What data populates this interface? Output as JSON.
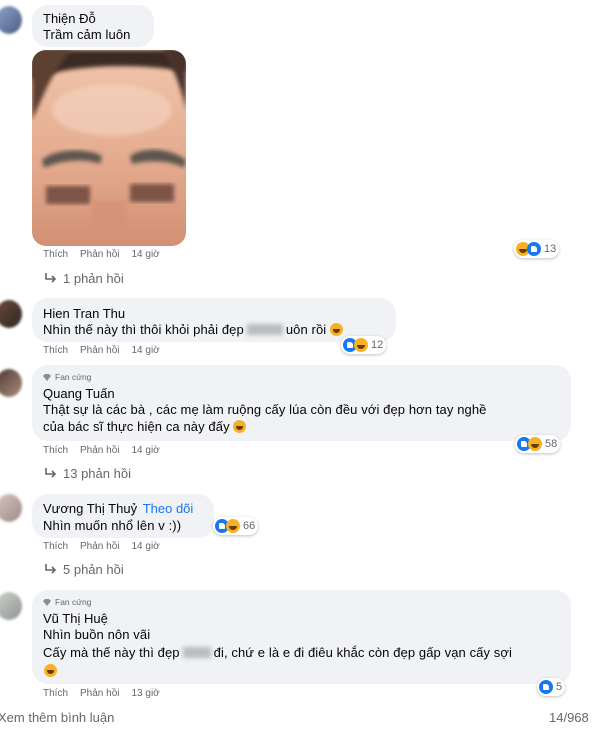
{
  "common": {
    "like": "Thích",
    "reply": "Phản hồi"
  },
  "comments": [
    {
      "name": "Thiện Đỗ",
      "lines": [
        "Trầm cảm luôn"
      ],
      "time": "14 giờ",
      "reactions": {
        "icons": [
          "haha-icon",
          "like-icon"
        ],
        "count": "13"
      },
      "replies": "1 phản hồi"
    },
    {
      "name": "Hien Tran Thu",
      "lines": [
        "Nhìn thế này thì thôi khỏi phải đẹp",
        "uôn rồi"
      ],
      "time": "14 giờ",
      "reactions": {
        "icons": [
          "like-icon",
          "haha-icon"
        ],
        "count": "12"
      }
    },
    {
      "badge": "Fan cứng",
      "name": "Quang Tuấn",
      "lines": [
        "Thật sự là các bà , các mẹ làm ruộng cấy lúa còn đều với đẹp hơn tay nghề",
        "của bác sĩ thực hiện ca này đấy"
      ],
      "time": "14 giờ",
      "reactions": {
        "icons": [
          "like-icon",
          "haha-icon"
        ],
        "count": "58"
      },
      "replies": "13 phản hồi"
    },
    {
      "name": "Vương Thị Thuỷ",
      "follow": "Theo dõi",
      "lines": [
        "Nhìn muốn nhổ lên v :))"
      ],
      "time": "14 giờ",
      "reactions": {
        "icons": [
          "like-icon",
          "haha-icon"
        ],
        "count": "66"
      },
      "replies": "5 phản hồi"
    },
    {
      "badge": "Fan cứng",
      "name": "Vũ Thị Huệ",
      "lines": [
        "Nhìn buồn nôn vãi",
        "Cấy mà thế này thì đẹp",
        "đi, chứ e là e đi điêu khắc còn đẹp gấp vạn cấy sợi"
      ],
      "time": "13 giờ",
      "reactions": {
        "icons": [
          "like-icon"
        ],
        "count": "5"
      }
    }
  ],
  "footer": {
    "more": "Xem thêm bình luận",
    "pagination": "14/968"
  },
  "colors": {
    "bubble": "#f0f2f5",
    "meta": "#65676b",
    "link": "#1877f2",
    "like": "#1877f2",
    "haha": "#f7b125"
  }
}
